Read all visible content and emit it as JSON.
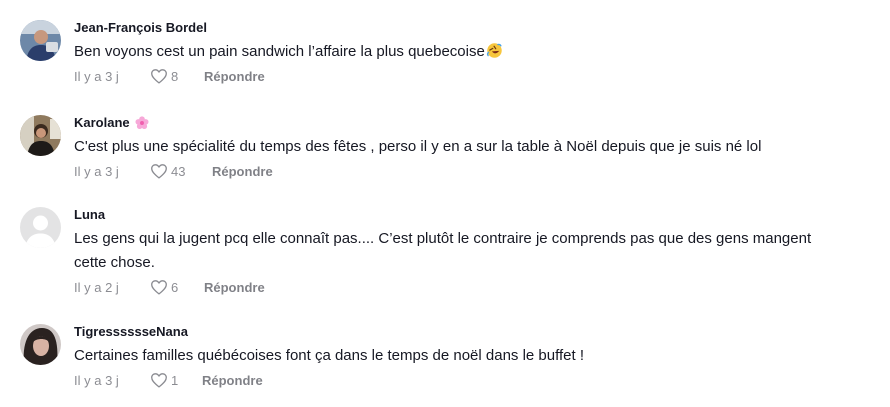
{
  "comments": [
    {
      "username": "Jean-François Bordel",
      "text": "Ben voyons cest un pain sandwich l’affaire la plus quebecoise",
      "emoji_icon": "rolling-on-floor-laughing-emoji",
      "time": "Il y a 3 j",
      "likes": "8",
      "reply": "Répondre"
    },
    {
      "username": "Karolane",
      "badge_icon": "pink-flower-emoji",
      "text": "C'est plus une spécialité du temps des fêtes , perso il y en a sur la table à Noël depuis que je suis né lol",
      "time": "Il y a 3 j",
      "likes": "43",
      "reply": "Répondre"
    },
    {
      "username": "Luna",
      "avatar_icon": "default-avatar-icon",
      "text": "Les gens qui la jugent pcq elle connaît pas.... C’est plutôt le contraire je comprends pas que des gens mangent cette chose.",
      "time": "Il y a 2 j",
      "likes": "6",
      "reply": "Répondre"
    },
    {
      "username": "TigresssssseNana",
      "text": "Certaines familles québécoises font ça dans le temps de noël dans le buffet !",
      "time": "Il y a 3 j",
      "likes": "1",
      "reply": "Répondre"
    }
  ],
  "colors": {
    "text_primary": "#161823",
    "text_secondary": "rgba(22,24,35,0.5)",
    "flower": "#f7a8d8"
  }
}
